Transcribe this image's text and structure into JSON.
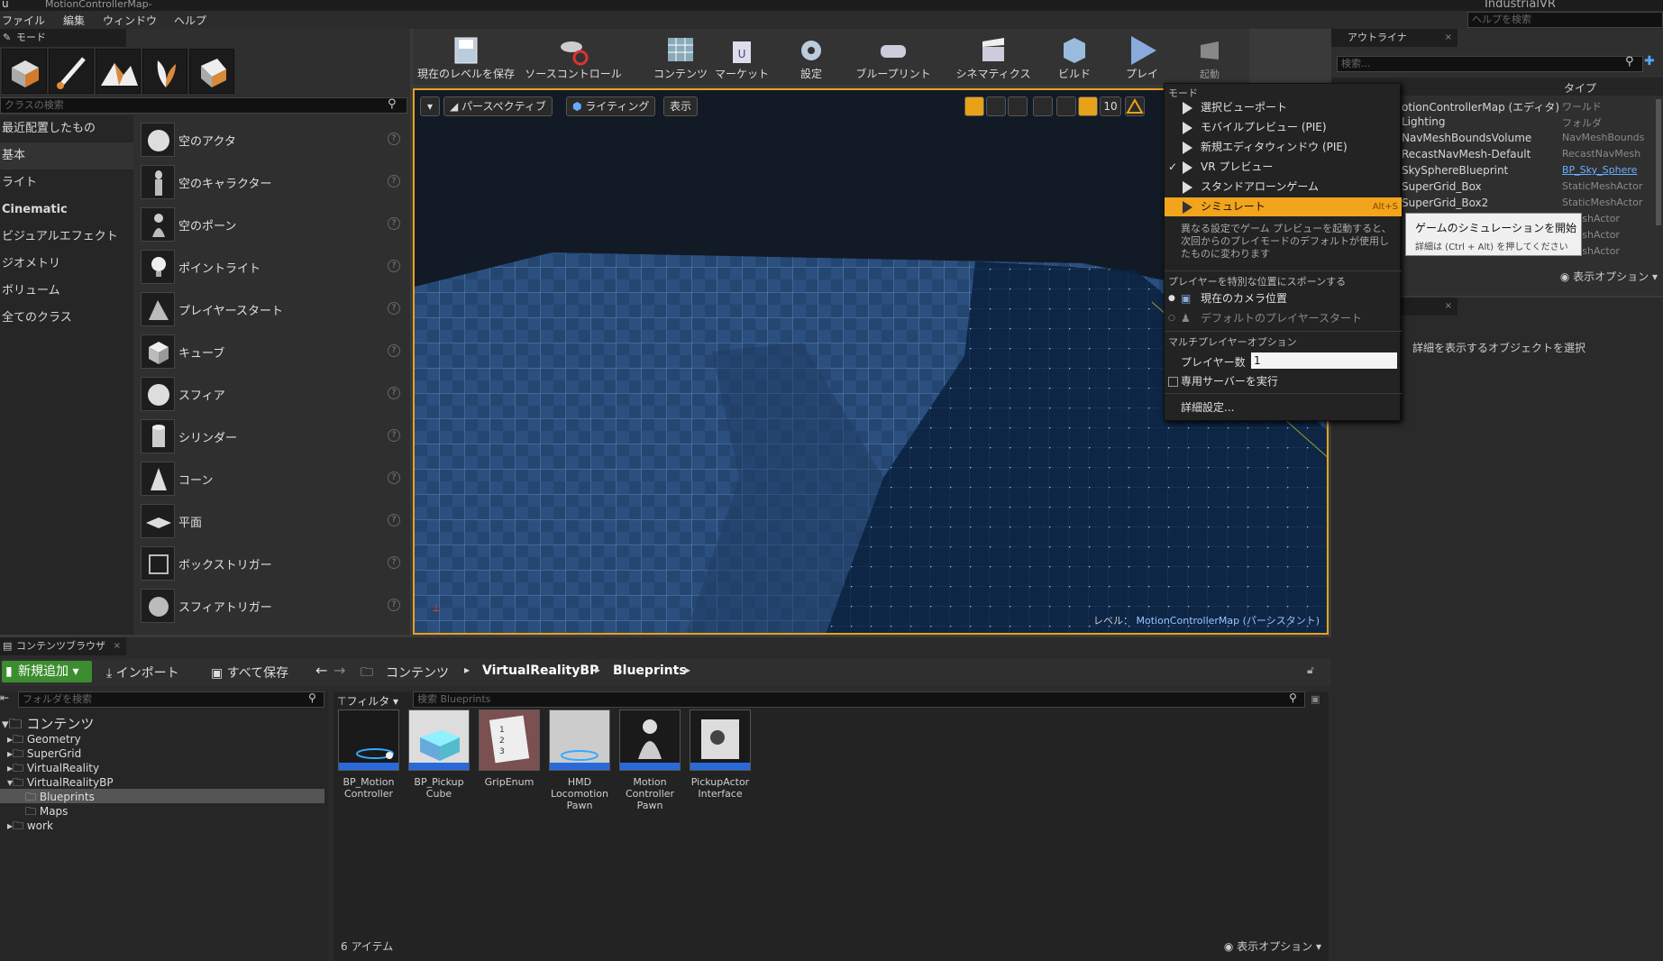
{
  "window": {
    "title": "MotionControllerMap-",
    "app_name": "IndustrialVR"
  },
  "menu": [
    "ファイル",
    "編集",
    "ウィンドウ",
    "ヘルプ"
  ],
  "help_search_placeholder": "ヘルプを検索",
  "modes": {
    "tab": "モード",
    "search_placeholder": "クラスの検索",
    "categories": [
      "最近配置したもの",
      "基本",
      "ライト",
      "Cinematic",
      "ビジュアルエフェクト",
      "ジオメトリ",
      "ボリューム",
      "全てのクラス"
    ],
    "actors": [
      "空のアクタ",
      "空のキャラクター",
      "空のポーン",
      "ポイントライト",
      "プレイヤースタート",
      "キューブ",
      "スフィア",
      "シリンダー",
      "コーン",
      "平面",
      "ボックストリガー",
      "スフィアトリガー"
    ]
  },
  "toolbar": [
    "現在のレベルを保存",
    "ソースコントロール",
    "コンテンツ",
    "マーケット",
    "設定",
    "ブループリント",
    "シネマティクス",
    "ビルド",
    "プレイ",
    "起動"
  ],
  "viewport": {
    "perspective": "パースペクティブ",
    "lighting": "ライティング",
    "show": "表示",
    "grid_value": "10",
    "level_label": "レベル：",
    "level_name": "MotionControllerMap (パーシスタント)"
  },
  "play_menu": {
    "mode_header": "モード",
    "items": [
      "選択ビューポート",
      "モバイルプレビュー (PIE)",
      "新規エディタウィンドウ (PIE)",
      "VR プレビュー",
      "スタンドアローンゲーム",
      "シミュレート"
    ],
    "shortcut": "Alt+S",
    "description": "異なる設定でゲーム プレビューを起動すると、次回からのプレイモードのデフォルトが使用したものに変わります",
    "spawn_header": "プレイヤーを特別な位置にスポーンする",
    "spawn_options": [
      "現在のカメラ位置",
      "デフォルトのプレイヤースタート"
    ],
    "mp_header": "マルチプレイヤーオプション",
    "player_count_label": "プレイヤー数",
    "player_count": "1",
    "dedicated_server": "専用サーバーを実行",
    "advanced": "詳細設定..."
  },
  "tooltip": {
    "title": "ゲームのシミュレーションを開始",
    "detail": "詳細は (Ctrl + Alt) を押してください"
  },
  "outliner": {
    "tab": "アウトライナ",
    "search_placeholder": "検索...",
    "col_type": "タイプ",
    "rows": [
      {
        "name": "otionControllerMap (エディタ)",
        "type": "ワールド"
      },
      {
        "name": "Lighting",
        "type": "フォルダ"
      },
      {
        "name": "NavMeshBoundsVolume",
        "type": "NavMeshBounds"
      },
      {
        "name": "RecastNavMesh-Default",
        "type": "RecastNavMesh"
      },
      {
        "name": "SkySphereBlueprint",
        "type": "BP_Sky_Sphere"
      },
      {
        "name": "SuperGrid_Box",
        "type": "StaticMeshActor"
      },
      {
        "name": "SuperGrid_Box2",
        "type": "StaticMeshActor"
      },
      {
        "name": "",
        "type": "cMeshActor"
      },
      {
        "name": "",
        "type": "cMeshActor"
      },
      {
        "name": "",
        "type": "cMeshActor"
      }
    ],
    "view_options": "表示オプション"
  },
  "details": {
    "hint": "詳細を表示するオブジェクトを選択"
  },
  "content_browser": {
    "tab": "コンテンツブラウザ",
    "add_new": "新規追加",
    "import": "インポート",
    "save_all": "すべて保存",
    "path": [
      "コンテンツ",
      "VirtualRealityBP",
      "Blueprints"
    ],
    "folder_search_placeholder": "フォルダを検索",
    "filter": "フィルタ",
    "asset_search_placeholder": "検索 Blueprints",
    "tree": [
      "コンテンツ",
      "Geometry",
      "SuperGrid",
      "VirtualReality",
      "VirtualRealityBP",
      "Blueprints",
      "Maps",
      "work"
    ],
    "assets": [
      "BP_Motion Controller",
      "BP_Pickup Cube",
      "GripEnum",
      "HMD Locomotion Pawn",
      "Motion Controller Pawn",
      "PickupActor Interface"
    ],
    "item_count": "6 アイテム",
    "view_options": "表示オプション"
  }
}
